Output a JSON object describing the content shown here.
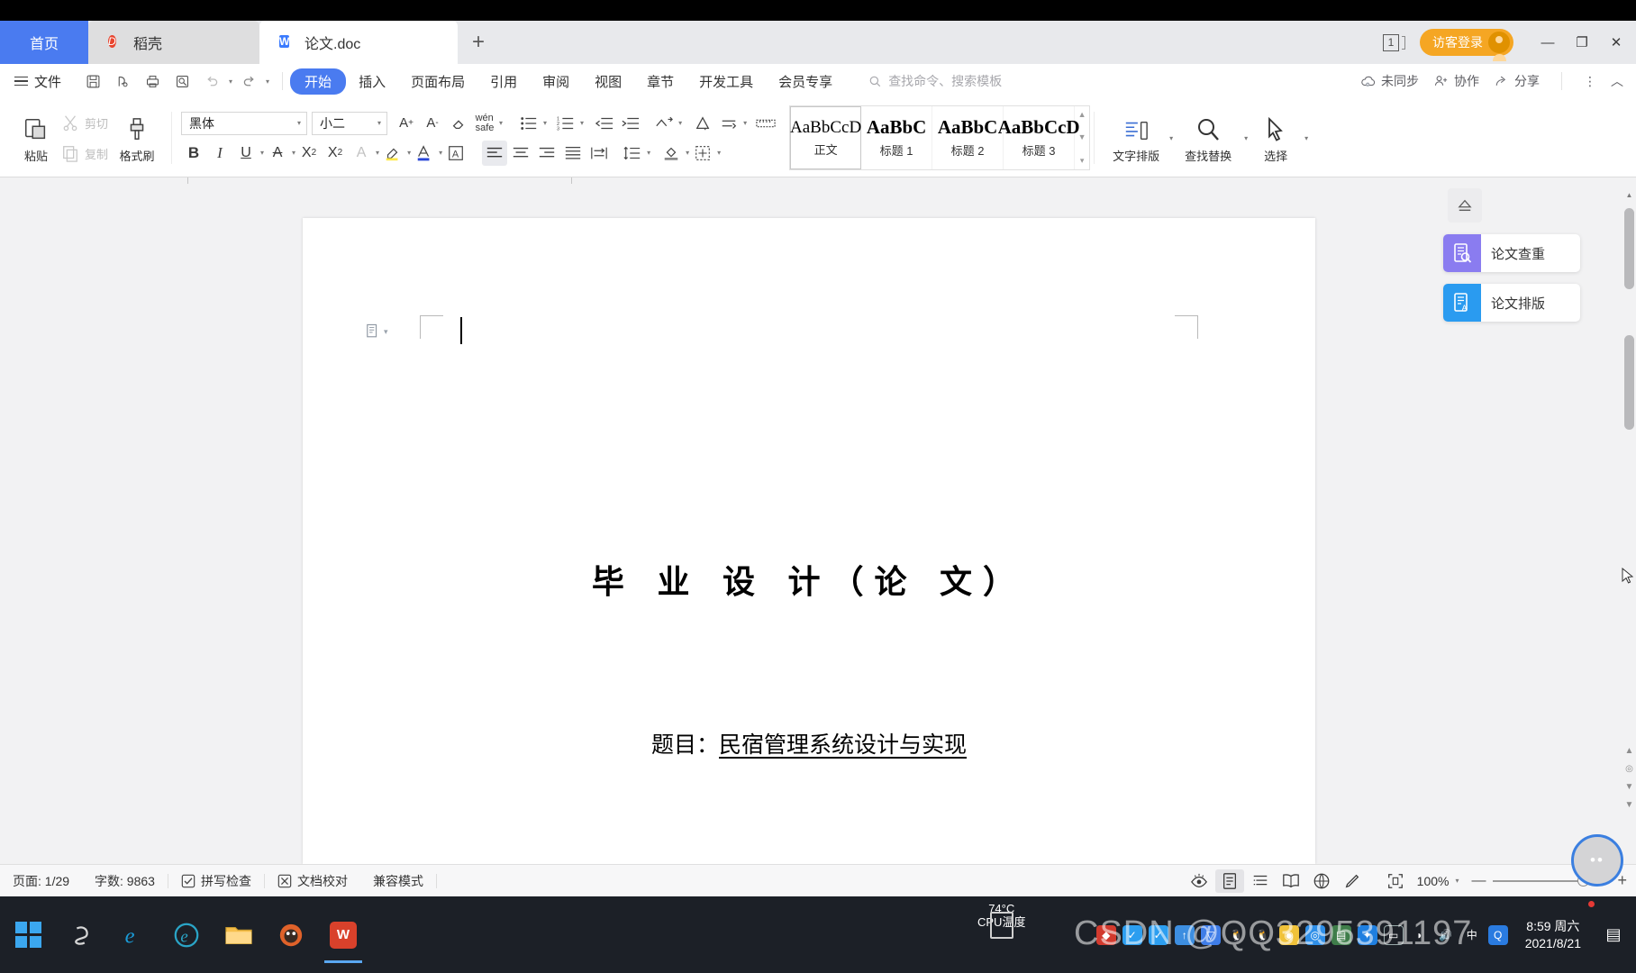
{
  "window": {
    "tabs": [
      {
        "label": "首页",
        "icon": "home-icon",
        "state": "home"
      },
      {
        "label": "稻壳",
        "icon": "docer-icon",
        "state": "inactive"
      },
      {
        "label": "论文.doc",
        "icon": "wps-writer-icon",
        "state": "active"
      }
    ],
    "new_tab_label": "+",
    "window_count_badge": "1",
    "login_label": "访客登录",
    "minimize": "—",
    "maximize": "❐",
    "close": "✕"
  },
  "menubar": {
    "file_label": "文件",
    "quick_access": [
      "save-icon",
      "save-as-cloud-icon",
      "print-icon",
      "print-preview-icon",
      "undo-icon",
      "redo-icon",
      "customize-qat-icon"
    ],
    "items": [
      {
        "label": "开始",
        "active": true
      },
      {
        "label": "插入",
        "active": false
      },
      {
        "label": "页面布局",
        "active": false
      },
      {
        "label": "引用",
        "active": false
      },
      {
        "label": "审阅",
        "active": false
      },
      {
        "label": "视图",
        "active": false
      },
      {
        "label": "章节",
        "active": false
      },
      {
        "label": "开发工具",
        "active": false
      },
      {
        "label": "会员专享",
        "active": false
      }
    ],
    "search_placeholder": "查找命令、搜索模板",
    "right": [
      {
        "label": "未同步",
        "icon": "cloud-unsynced-icon"
      },
      {
        "label": "协作",
        "icon": "collaborate-icon"
      },
      {
        "label": "分享",
        "icon": "share-icon"
      }
    ],
    "more_label": "⋮",
    "collapse_label": "︿"
  },
  "ribbon": {
    "paste_label": "粘贴",
    "cut_label": "剪切",
    "copy_label": "复制",
    "format_painter_label": "格式刷",
    "font_name": "黑体",
    "font_size": "小二",
    "row1_icons": [
      "grow-font-icon",
      "shrink-font-icon",
      "clear-format-icon",
      "pinyin-guide-icon",
      "bullets-icon",
      "numbering-icon",
      "decrease-indent-icon",
      "increase-indent-icon",
      "sort-icon",
      "show-marks-icon",
      "line-break-icon",
      "ruler-icon"
    ],
    "row2_icons": [
      "bold-icon",
      "italic-icon",
      "underline-icon",
      "strikethrough-icon",
      "superscript-icon",
      "subscript-icon",
      "text-effect-icon",
      "highlight-icon",
      "font-color-icon",
      "character-border-icon",
      "align-left-icon",
      "align-center-icon",
      "align-right-icon",
      "justify-icon",
      "distribute-icon",
      "line-spacing-icon",
      "shading-icon",
      "borders-icon"
    ],
    "bold_label": "B",
    "italic_label": "I",
    "underline_label": "U",
    "styles": [
      {
        "sample": "AaBbCcD",
        "name": "正文",
        "selected": true,
        "bold": false
      },
      {
        "sample": "AaBbC",
        "name": "标题 1",
        "selected": false,
        "bold": true
      },
      {
        "sample": "AaBbC",
        "name": "标题 2",
        "selected": false,
        "bold": true
      },
      {
        "sample": "AaBbCcD",
        "name": "标题 3",
        "selected": false,
        "bold": true
      }
    ],
    "text_layout_label": "文字排版",
    "find_replace_label": "查找替换",
    "select_label": "选择"
  },
  "document": {
    "title": "毕 业 设 计（论 文）",
    "subject_prefix": "题目：",
    "subject": "民宿管理系统设计与实现"
  },
  "side_panel": {
    "eject_icon": "eject-icon",
    "items": [
      {
        "label": "论文查重",
        "icon": "plagiarism-check-icon",
        "color": "#8a7cf0"
      },
      {
        "label": "论文排版",
        "icon": "thesis-format-icon",
        "color": "#2a9bf0"
      }
    ]
  },
  "statusbar": {
    "page_label": "页面: 1/29",
    "word_count_label": "字数: 9863",
    "spellcheck_label": "拼写检查",
    "proofread_label": "文档校对",
    "compat_label": "兼容模式",
    "view_icons": [
      "focus-eye-icon",
      "print-layout-icon",
      "outline-icon",
      "read-mode-icon",
      "web-layout-icon",
      "edit-pen-icon",
      "fit-page-icon"
    ],
    "zoom_level": "100%",
    "zoom_out": "—",
    "zoom_in": "+"
  },
  "taskbar": {
    "start_icon": "windows-start-icon",
    "apps": [
      {
        "name": "cortana-icon",
        "glyph": "S",
        "color": "#1c2027"
      },
      {
        "name": "internet-explorer-icon",
        "glyph": "e",
        "color": "#1a9bd7"
      },
      {
        "name": "edge-icon",
        "glyph": "e",
        "color": "#2aa5c7"
      },
      {
        "name": "file-explorer-icon",
        "glyph": "▤",
        "color": "#f7bf4b"
      },
      {
        "name": "firefox-icon",
        "glyph": "🦊",
        "color": "#e0622a"
      },
      {
        "name": "wps-writer-icon",
        "glyph": "W",
        "color": "#d9412b"
      }
    ],
    "cpu_temp_value": "74°C",
    "cpu_temp_label": "CPU温度",
    "tray_icons": [
      "security-icon",
      "wechat-icon",
      "wechat-work-icon",
      "uploader-icon",
      "shield-icon",
      "qq-icon",
      "qq-icon-2",
      "fund-icon",
      "watch-icon",
      "note-icon",
      "bluetooth-icon",
      "battery-icon",
      "wifi-icon",
      "volume-icon",
      "ime-cn-icon",
      "qq-browser-icon"
    ],
    "ime_label": "中",
    "clock_time": "8:59 周六",
    "clock_date": "2021/8/21",
    "notification_icon": "action-center-icon"
  },
  "watermark": "CSDN @QQ3295391197"
}
